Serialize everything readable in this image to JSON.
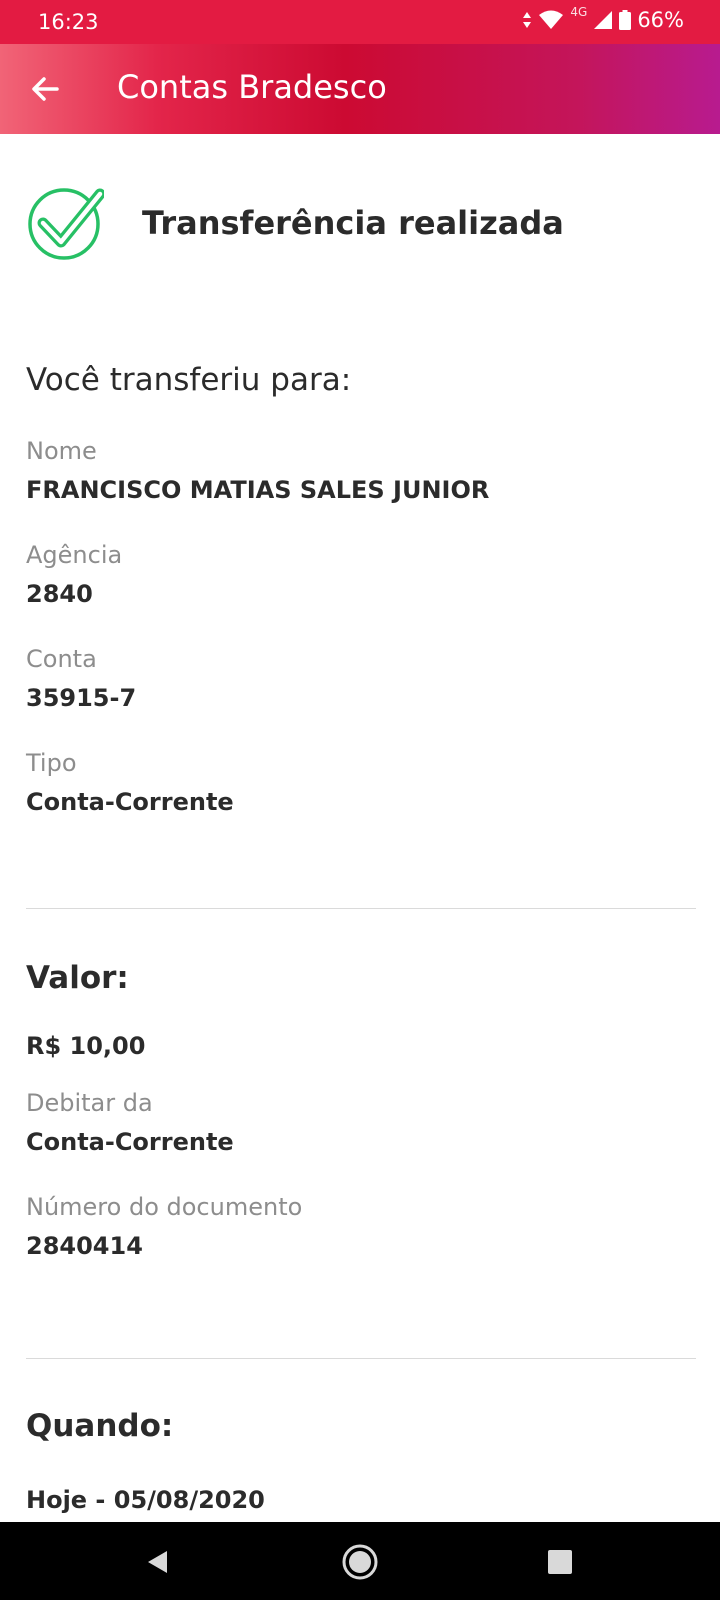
{
  "status_bar": {
    "time": "16:23",
    "network": "4G",
    "battery": "66%"
  },
  "app_bar": {
    "back_icon": "arrow-left-icon",
    "title": "Contas Bradesco"
  },
  "success": {
    "icon": "check-circle-icon",
    "message": "Transferência realizada"
  },
  "recipient": {
    "heading": "Você transferiu para:",
    "fields": [
      {
        "label": "Nome",
        "value": "FRANCISCO MATIAS SALES JUNIOR"
      },
      {
        "label": "Agência",
        "value": "2840"
      },
      {
        "label": "Conta",
        "value": "35915-7"
      },
      {
        "label": "Tipo",
        "value": "Conta-Corrente"
      }
    ]
  },
  "amount": {
    "heading": "Valor:",
    "value": "R$ 10,00",
    "fields": [
      {
        "label": "Debitar da",
        "value": "Conta-Corrente"
      },
      {
        "label": "Número do documento",
        "value": "2840414"
      }
    ]
  },
  "when": {
    "heading": "Quando:",
    "value": "Hoje - 05/08/2020"
  },
  "colors": {
    "status_bar": "#e31b42",
    "success_green": "#27c065",
    "label_gray": "#8d8d8d",
    "text_dark": "#2b2b2b"
  },
  "nav_bar": {
    "icons": [
      "back-triangle-icon",
      "home-circle-icon",
      "recents-square-icon"
    ]
  }
}
